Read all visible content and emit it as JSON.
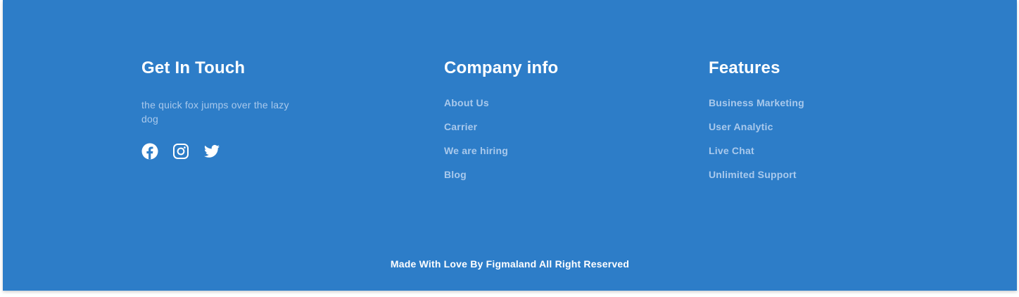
{
  "footer": {
    "background_color": "#2d7dc8",
    "touch": {
      "title": "Get In Touch",
      "text": "the quick fox jumps over the lazy dog",
      "socials": [
        {
          "icon": "facebook-icon"
        },
        {
          "icon": "instagram-icon"
        },
        {
          "icon": "twitter-icon"
        }
      ]
    },
    "company": {
      "title": "Company info",
      "links": [
        {
          "label": "About Us"
        },
        {
          "label": "Carrier"
        },
        {
          "label": "We are hiring"
        },
        {
          "label": "Blog"
        }
      ]
    },
    "features": {
      "title": "Features",
      "links": [
        {
          "label": "Business Marketing"
        },
        {
          "label": "User Analytic"
        },
        {
          "label": "Live Chat"
        },
        {
          "label": "Unlimited Support"
        }
      ]
    },
    "copyright": "Made With Love By Figmaland All Right Reserved"
  }
}
